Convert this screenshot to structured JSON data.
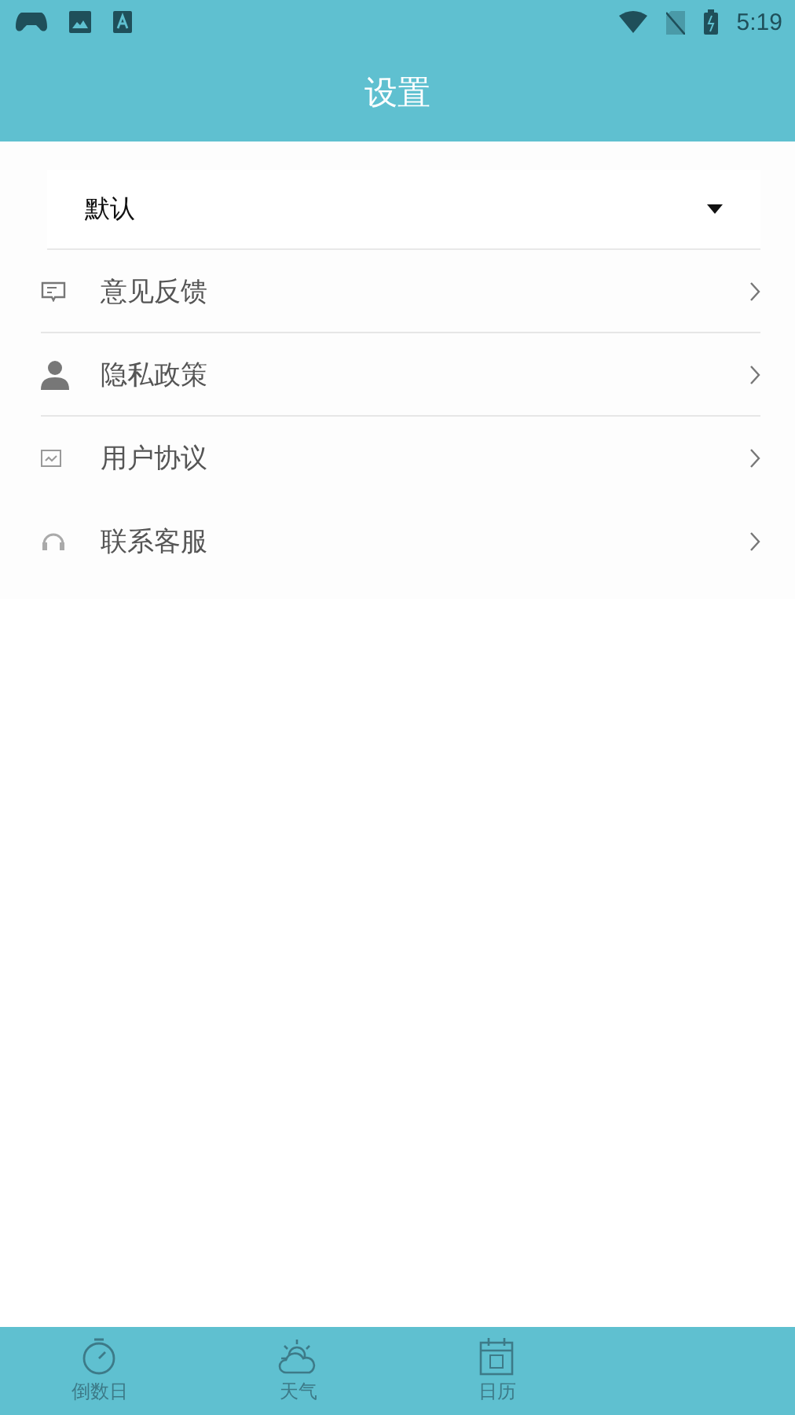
{
  "status_bar": {
    "time": "5:19"
  },
  "header": {
    "title": "设置"
  },
  "dropdown": {
    "value": "默认"
  },
  "menu": [
    {
      "label": "意见反馈",
      "kind": "feedback",
      "divider": true
    },
    {
      "label": "隐私政策",
      "kind": "person",
      "divider": true
    },
    {
      "label": "用户协议",
      "kind": "doc",
      "divider": false
    },
    {
      "label": "联系客服",
      "kind": "headset",
      "divider": false
    }
  ],
  "tabs": [
    {
      "label": "倒数日",
      "kind": "timer",
      "selected": false
    },
    {
      "label": "天气",
      "kind": "weather",
      "selected": false
    },
    {
      "label": "日历",
      "kind": "calendar",
      "selected": false
    }
  ]
}
